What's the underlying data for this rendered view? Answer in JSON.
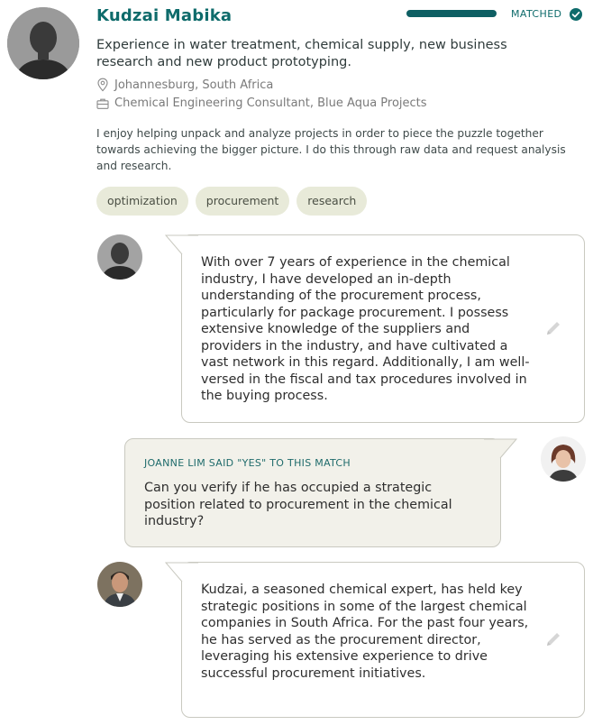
{
  "profile": {
    "name": "Kudzai Mabika",
    "match_status": "MATCHED",
    "match_progress": 1.0,
    "headline": "Experience in water treatment, chemical supply, new business research and new product prototyping.",
    "location": "Johannesburg, South Africa",
    "position": "Chemical Engineering Consultant, Blue Aqua Projects",
    "about": "I enjoy helping unpack and analyze projects in order to piece the puzzle together towards achieving the bigger picture. I do this through raw data and request analysis and research.",
    "tags": [
      "optimization",
      "procurement",
      "research"
    ]
  },
  "messages": [
    {
      "text": "With over 7 years of experience in the chemical industry, I have developed an in-depth understanding of the procurement process, particularly for package procurement. I possess extensive knowledge of the suppliers and providers in the industry, and have cultivated a vast network in this regard. Additionally, I am well-versed in the fiscal and tax procedures involved in the buying process."
    },
    {
      "said": "JOANNE LIM SAID \"YES\" TO THIS MATCH",
      "text": "Can you verify if he has occupied a strategic position related to procurement in the chemical industry?"
    },
    {
      "text": "Kudzai, a seasoned chemical expert, has held key strategic positions in some of the largest chemical companies in South Africa. For the past four years, he has served as the procurement director, leveraging his extensive experience to drive successful procurement initiatives."
    }
  ],
  "colors": {
    "brand": "#0e6b6b",
    "tag_bg": "#e8ead9",
    "question_bubble_bg": "#f2f1ea"
  }
}
